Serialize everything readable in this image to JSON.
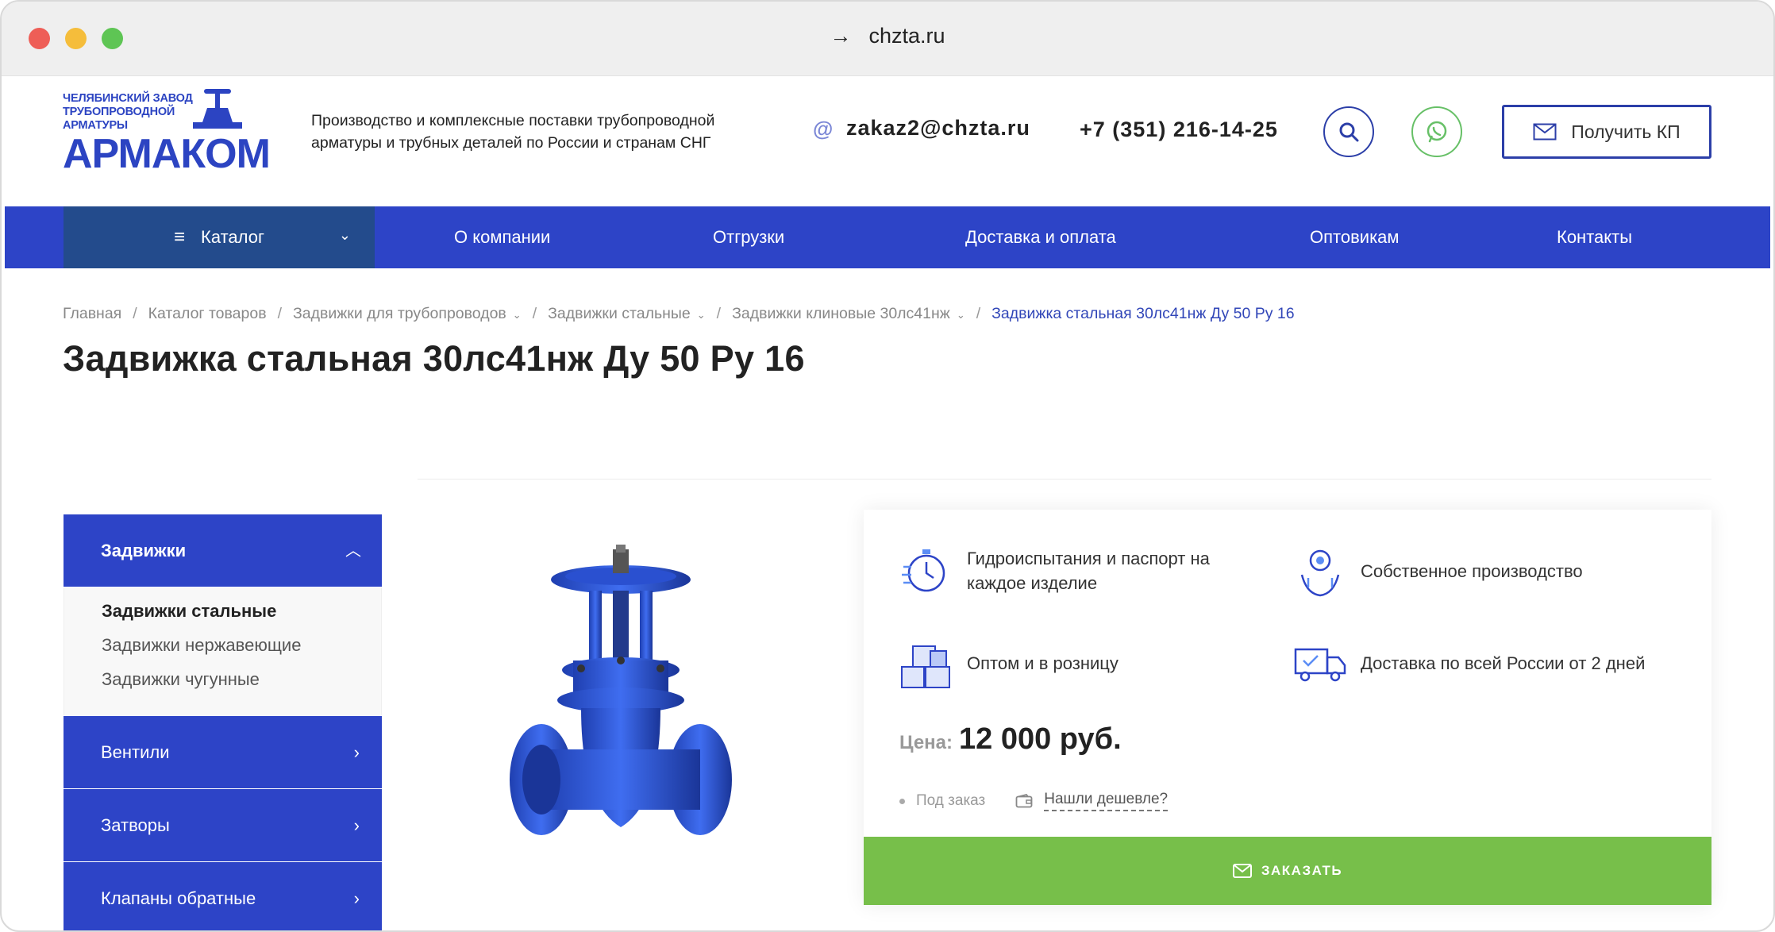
{
  "browser": {
    "url": "chzta.ru",
    "nav_arrow": "→"
  },
  "header": {
    "logo_small": "ЧЕЛЯБИНСКИЙ ЗАВОД ТРУБОПРОВОДНОЙ АРМАТУРЫ",
    "logo_big": "АРМАКОМ",
    "tagline": "Производство и комплексные поставки трубопроводной арматуры и трубных деталей по России и странам СНГ",
    "email_icon": "@",
    "email": "zakaz2@chzta.ru",
    "phone": "+7 (351) 216-14-25",
    "kp_button": "Получить КП"
  },
  "nav": {
    "catalog": "Каталог",
    "items": [
      "О компании",
      "Отгрузки",
      "Доставка и оплата",
      "Оптовикам",
      "Контакты"
    ]
  },
  "breadcrumb": {
    "items": [
      "Главная",
      "Каталог товаров",
      "Задвижки для трубопроводов",
      "Задвижки стальные",
      "Задвижки клиновые 30лс41нж"
    ],
    "current": "Задвижка стальная 30лс41нж Ду 50 Ру 16"
  },
  "page_title": "Задвижка стальная 30лс41нж Ду 50 Ру 16",
  "sidebar": {
    "head": "Задвижки",
    "sub": [
      "Задвижки стальные",
      "Задвижки нержавеющие",
      "Задвижки чугунные"
    ],
    "items": [
      "Вентили",
      "Затворы",
      "Клапаны обратные"
    ]
  },
  "features": [
    {
      "icon": "test-icon",
      "text": "Гидроиспытания и паспорт на каждое изделие"
    },
    {
      "icon": "production-icon",
      "text": "Собственное производство"
    },
    {
      "icon": "boxes-icon",
      "text": "Оптом и в розницу"
    },
    {
      "icon": "truck-icon",
      "text": "Доставка по всей России от 2 дней"
    }
  ],
  "price": {
    "label": "Цена:",
    "value": "12 000 руб."
  },
  "status": {
    "availability": "Под заказ",
    "cheaper": "Нашли дешевле?"
  },
  "order_button": "ЗАКАЗАТЬ",
  "colors": {
    "brand_blue": "#2d44c7",
    "catalog_dark": "#234b8c",
    "order_green": "#77bf4a",
    "whatsapp_green": "#67c067"
  }
}
